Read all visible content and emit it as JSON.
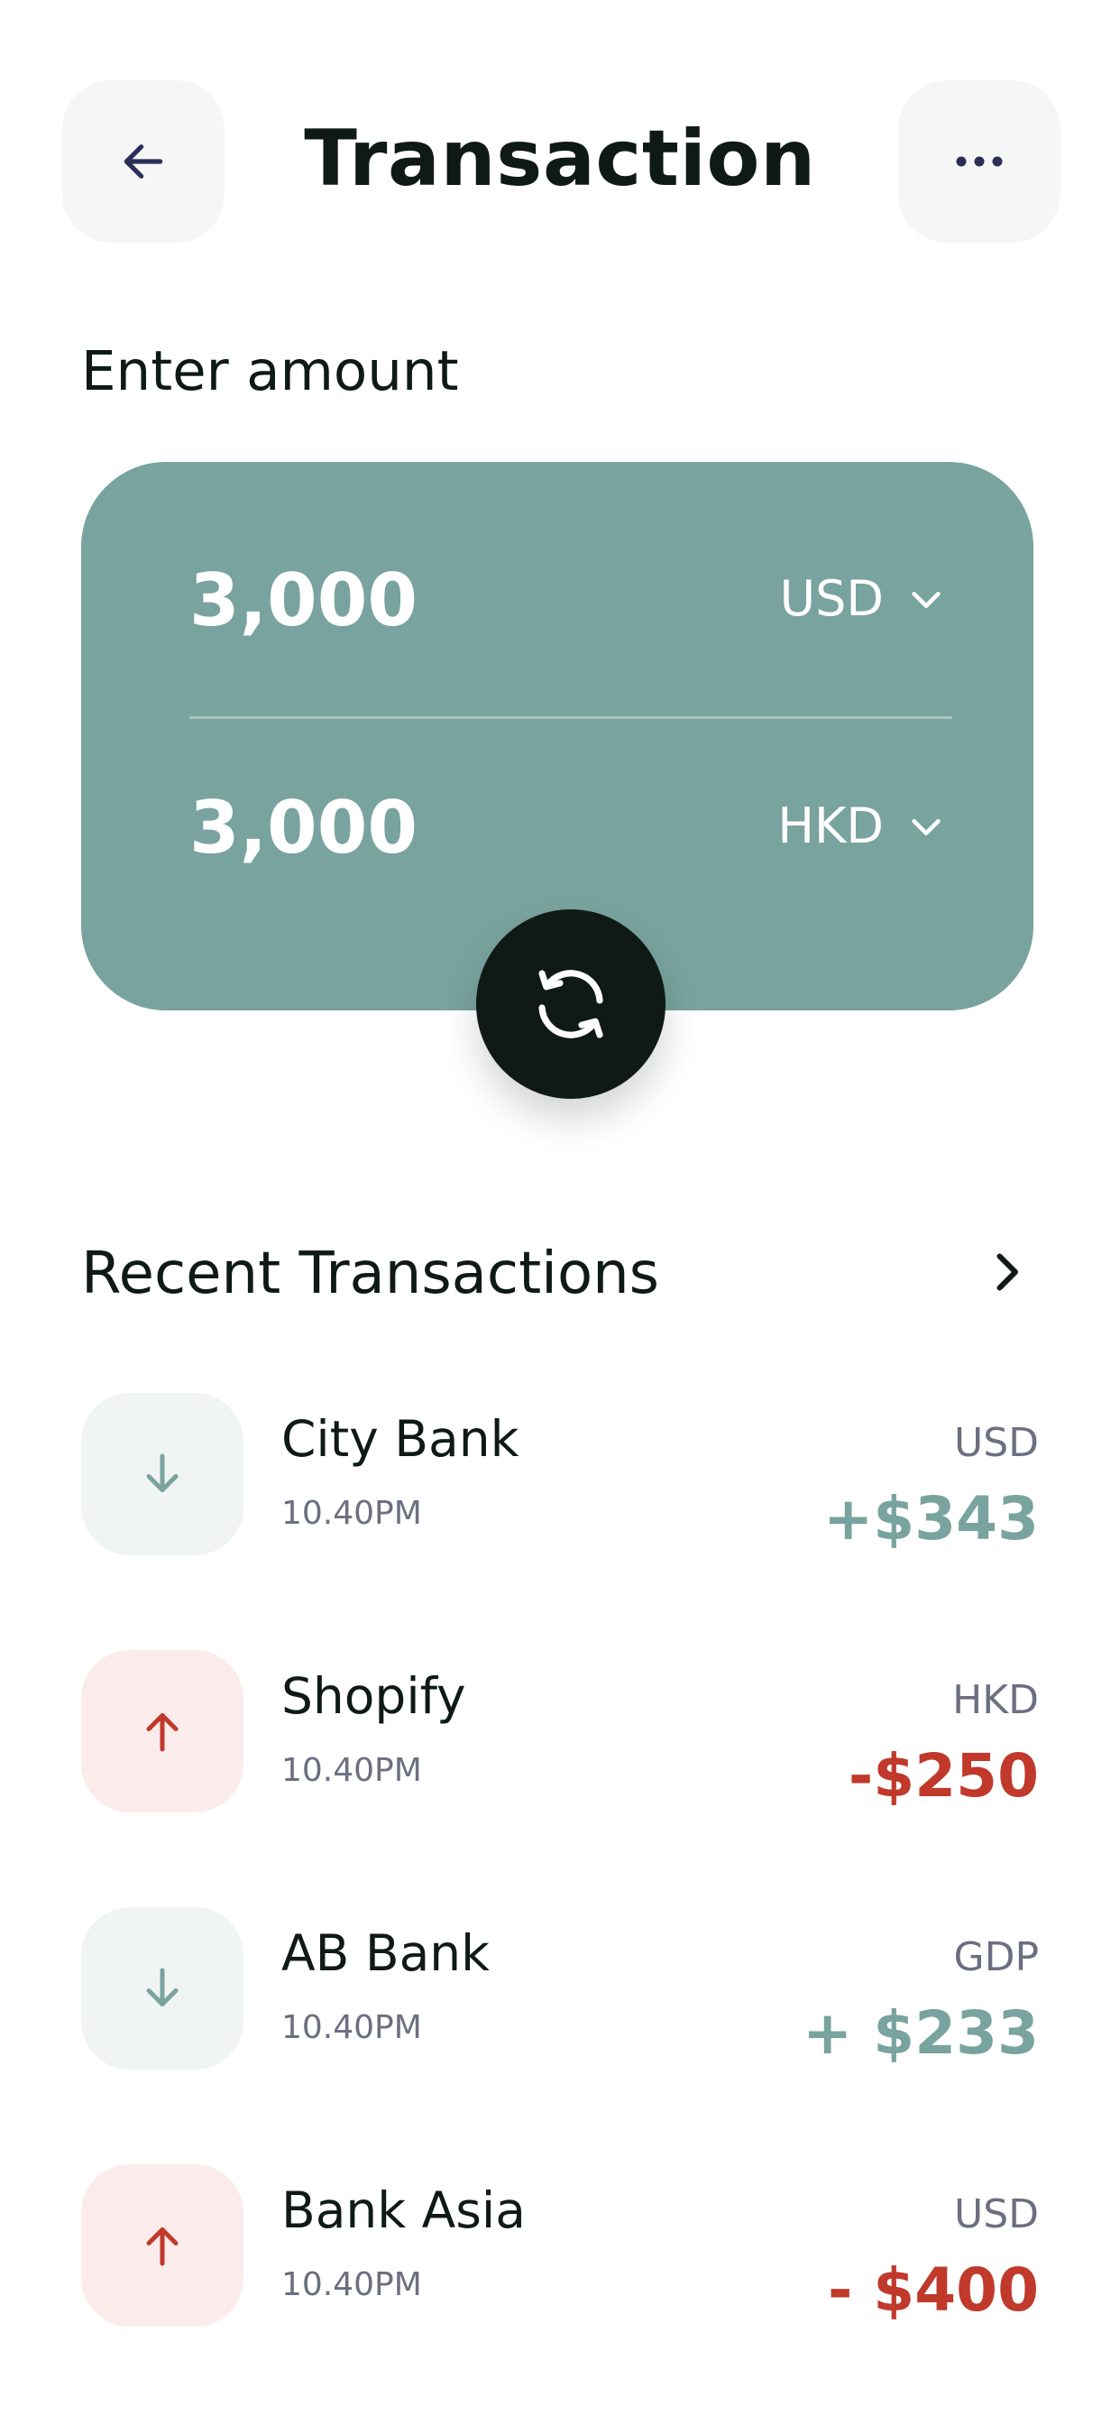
{
  "header": {
    "title": "Transaction",
    "back_icon": "arrow-left-icon",
    "more_icon": "more-horizontal-icon"
  },
  "amount_section": {
    "label": "Enter amount",
    "from": {
      "value": "3,000",
      "currency": "USD"
    },
    "to": {
      "value": "3,000",
      "currency": "HKD"
    },
    "swap_icon": "swap-refresh-icon"
  },
  "recent": {
    "title": "Recent Transactions",
    "items": [
      {
        "name": "City Bank",
        "time": "10.40PM",
        "currency": "USD",
        "amount": "+$343",
        "direction": "in"
      },
      {
        "name": "Shopify",
        "time": "10.40PM",
        "currency": "HKD",
        "amount": "-$250",
        "direction": "out"
      },
      {
        "name": "AB Bank",
        "time": "10.40PM",
        "currency": "GDP",
        "amount": "+ $233",
        "direction": "in"
      },
      {
        "name": "Bank Asia",
        "time": "10.40PM",
        "currency": "USD",
        "amount": "- $400",
        "direction": "out"
      }
    ]
  },
  "colors": {
    "card": "#79a39e",
    "dark": "#0f1a17",
    "incoming": "#79a39e",
    "outgoing": "#c0392b",
    "muted": "#6b6f80"
  }
}
